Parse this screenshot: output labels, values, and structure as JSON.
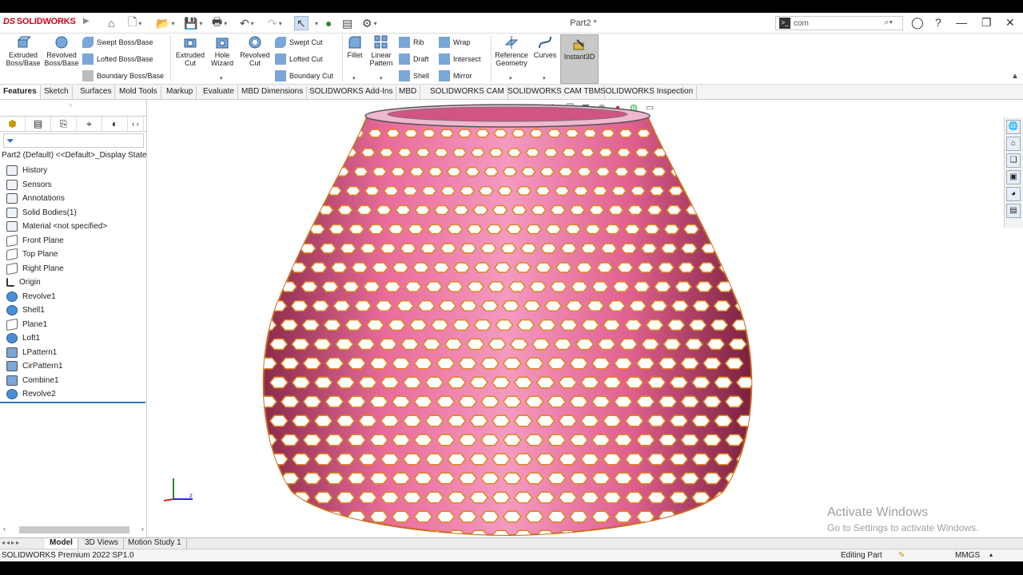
{
  "app": {
    "logo_ds": "DS",
    "logo_text": "SOLIDWORKS",
    "doc_title": "Part2 *"
  },
  "search": {
    "value": "com",
    "placeholder": ""
  },
  "ribbon": {
    "extruded_boss": "Extruded Boss/Base",
    "revolved_boss": "Revolved Boss/Base",
    "swept_boss": "Swept Boss/Base",
    "lofted_boss": "Lofted Boss/Base",
    "boundary_boss": "Boundary Boss/Base",
    "extruded_cut": "Extruded Cut",
    "hole_wizard": "Hole Wizard",
    "revolved_cut": "Revolved Cut",
    "swept_cut": "Swept Cut",
    "lofted_cut": "Lofted Cut",
    "boundary_cut": "Boundary Cut",
    "fillet": "Fillet",
    "linear_pattern": "Linear Pattern",
    "rib": "Rib",
    "draft": "Draft",
    "shell": "Shell",
    "wrap": "Wrap",
    "intersect": "Intersect",
    "mirror": "Mirror",
    "reference_geometry": "Reference Geometry",
    "curves": "Curves",
    "instant3d": "Instant3D"
  },
  "tabs": [
    "Features",
    "Sketch",
    "Surfaces",
    "Mold Tools",
    "Markup",
    "Evaluate",
    "MBD Dimensions",
    "SOLIDWORKS Add-Ins",
    "MBD",
    "SOLIDWORKS CAM",
    "SOLIDWORKS CAM TBM",
    "SOLIDWORKS Inspection"
  ],
  "tree": {
    "root": "Part2 (Default) <<Default>_Display State",
    "items": [
      "History",
      "Sensors",
      "Annotations",
      "Solid Bodies(1)",
      "Material <not specified>",
      "Front Plane",
      "Top Plane",
      "Right Plane",
      "Origin",
      "Revolve1",
      "Shell1",
      "Plane1",
      "Loft1",
      "LPattern1",
      "CirPattern1",
      "Combine1",
      "Revolve2"
    ]
  },
  "watermark": {
    "line1": "Activate Windows",
    "line2": "Go to Settings to activate Windows."
  },
  "bottom_tabs": [
    "Model",
    "3D Views",
    "Motion Study 1"
  ],
  "status": {
    "product": "SOLIDWORKS Premium 2022 SP1.0",
    "mode": "Editing Part",
    "units": "MMGS"
  },
  "model": {
    "color_body": "#e96b9b",
    "color_edges": "#e0871f"
  }
}
